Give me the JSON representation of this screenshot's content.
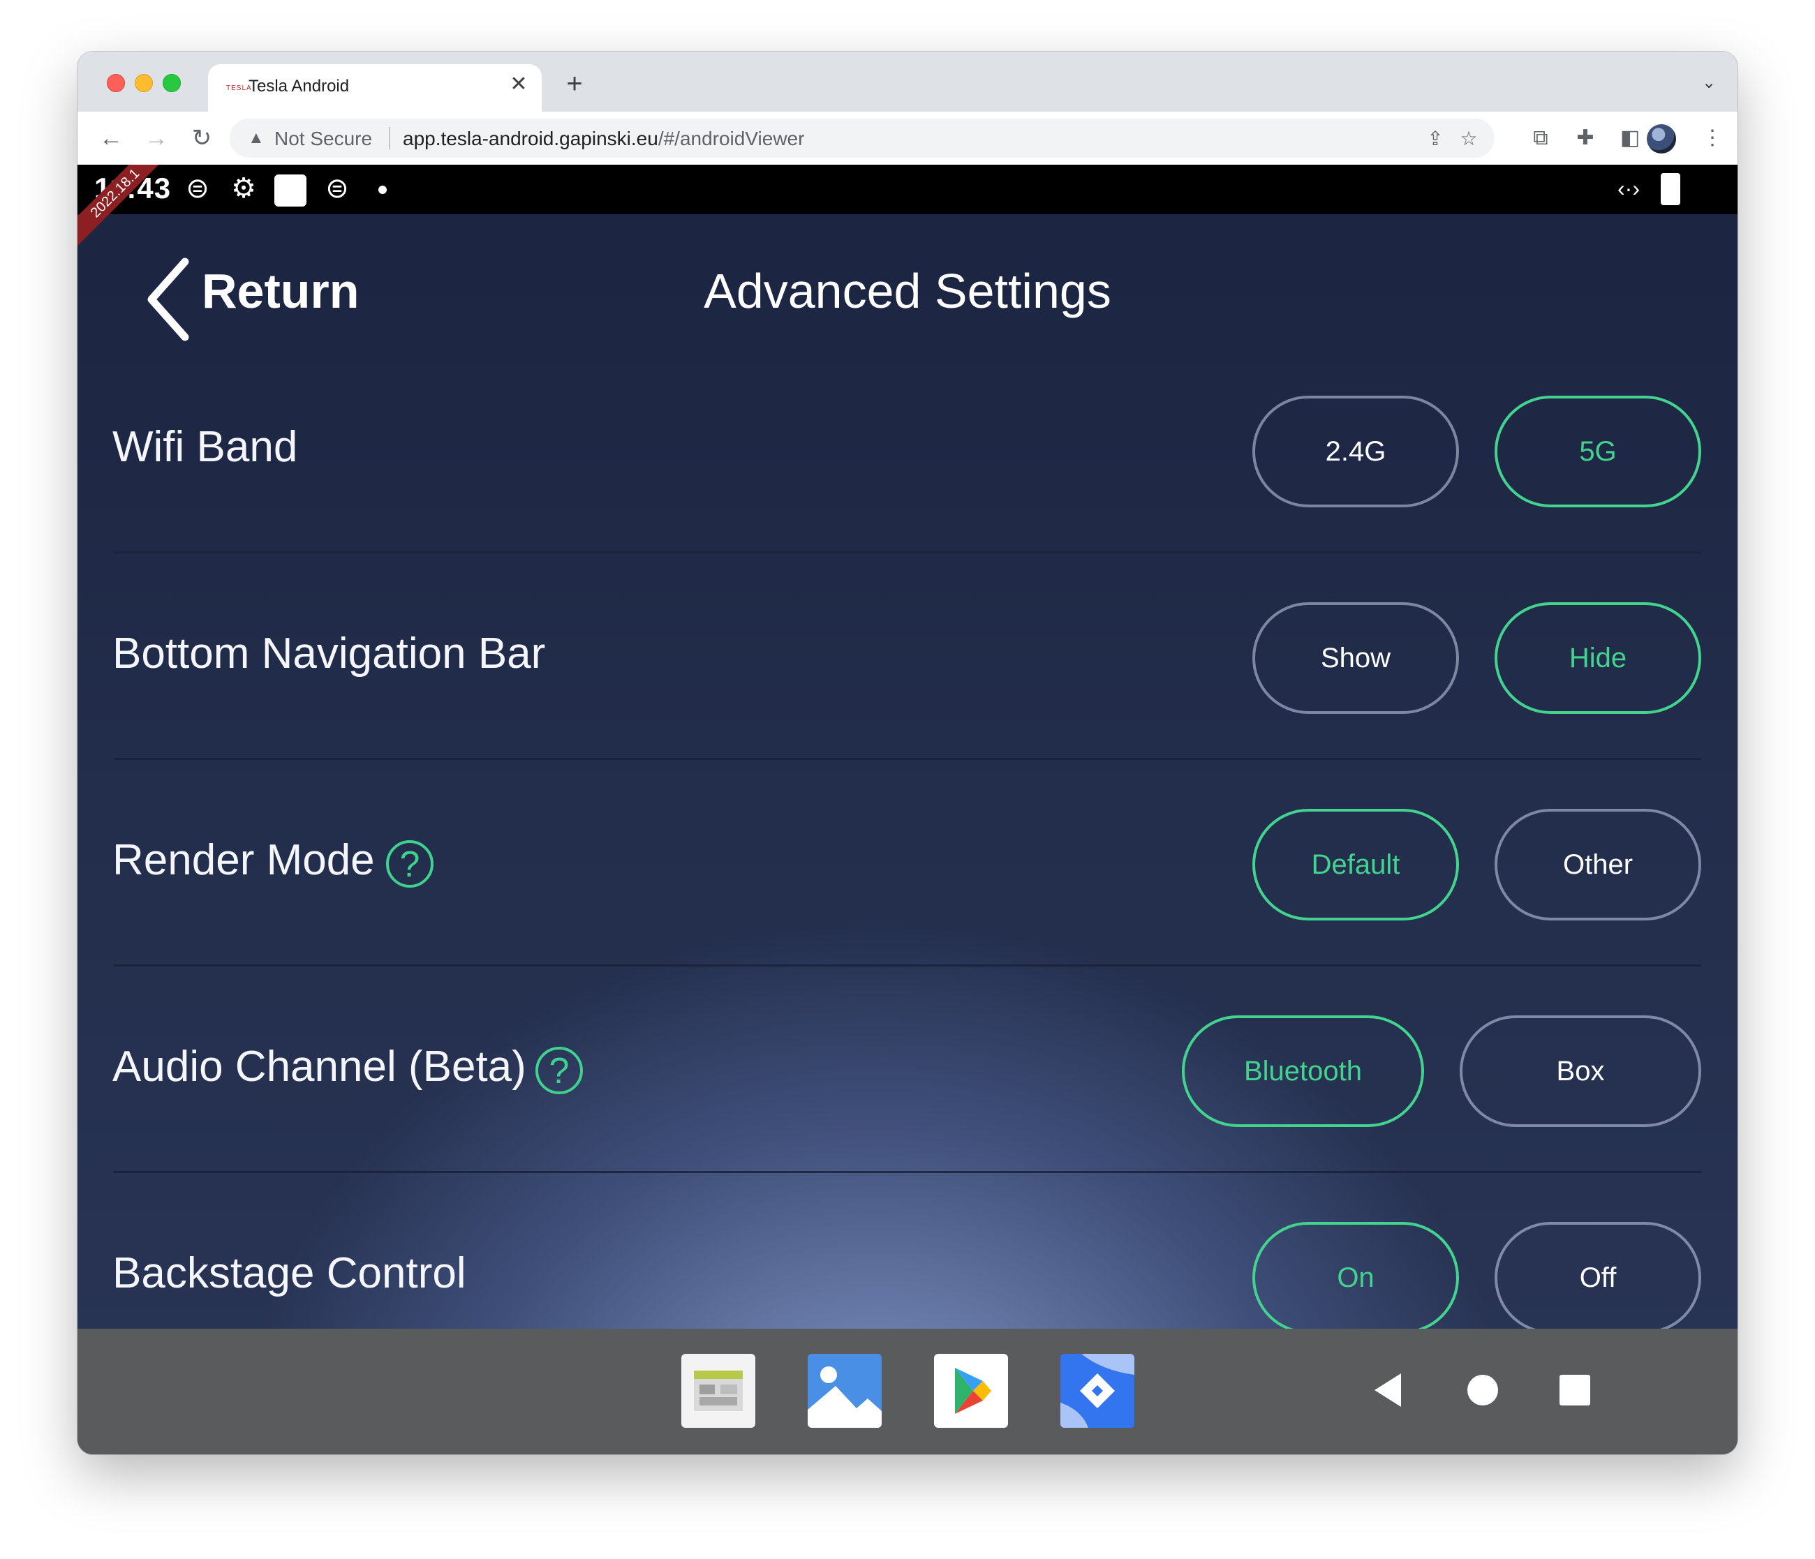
{
  "browser": {
    "tab_title": "Tesla Android",
    "tab_favicon": "TESLA",
    "tab_close": "✕",
    "new_tab": "+",
    "omnibox": {
      "security": "Not Secure",
      "url_host": "app.tesla-android.gapinski.eu",
      "url_path": "/#/androidViewer"
    },
    "icons": [
      "back-arrow-icon",
      "forward-arrow-icon",
      "reload-icon",
      "warning-icon",
      "share-icon",
      "star-icon",
      "tabs-icon",
      "extensions-icon",
      "sidepanel-icon",
      "avatar",
      "menu-icon",
      "tab-dropdown-icon"
    ]
  },
  "android": {
    "statusbar": {
      "time": "11:43",
      "ribbon": "2022.18.1"
    },
    "header": {
      "return_label": "Return",
      "title": "Advanced Settings"
    },
    "settings": [
      {
        "label": "Wifi Band",
        "help": false,
        "options": [
          {
            "label": "2.4G",
            "selected": false
          },
          {
            "label": "5G",
            "selected": true
          }
        ]
      },
      {
        "label": "Bottom Navigation Bar",
        "help": false,
        "options": [
          {
            "label": "Show",
            "selected": false
          },
          {
            "label": "Hide",
            "selected": true
          }
        ]
      },
      {
        "label": "Render Mode",
        "help": true,
        "options": [
          {
            "label": "Default",
            "selected": true
          },
          {
            "label": "Other",
            "selected": false
          }
        ]
      },
      {
        "label": "Audio Channel (Beta)",
        "help": true,
        "options": [
          {
            "label": "Bluetooth",
            "selected": true
          },
          {
            "label": "Box",
            "selected": false
          }
        ]
      },
      {
        "label": "Backstage Control",
        "help": false,
        "options": [
          {
            "label": "On",
            "selected": true
          },
          {
            "label": "Off",
            "selected": false
          }
        ]
      }
    ],
    "help_glyph": "?",
    "dock_apps": [
      "launcher-app-icon",
      "gallery-app-icon",
      "play-store-app-icon",
      "maps-app-icon"
    ],
    "system_buttons": [
      "back-icon",
      "home-icon",
      "recents-icon"
    ],
    "colors": {
      "accent": "#43d38f",
      "statusbar": "#000000",
      "navbar": "#5a5b5d"
    }
  }
}
